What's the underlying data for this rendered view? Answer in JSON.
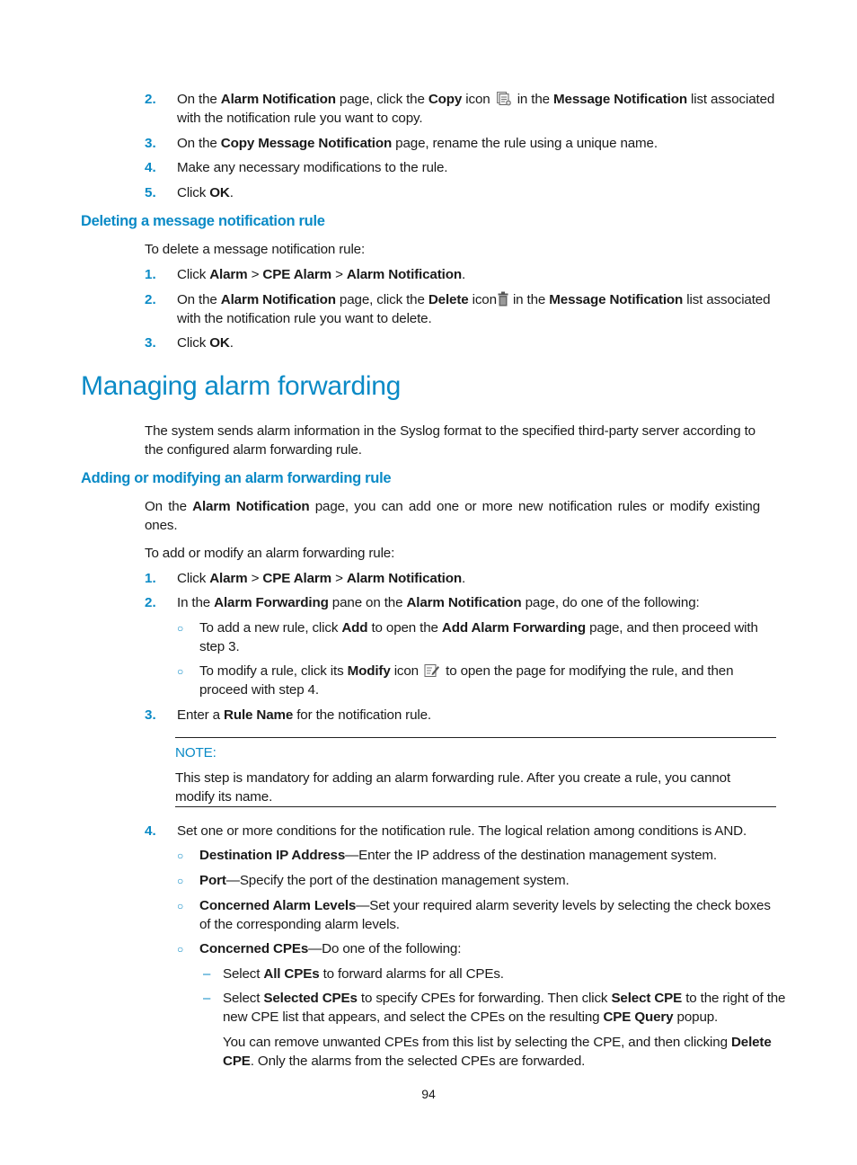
{
  "copy_section": {
    "steps": [
      {
        "num": "2.",
        "parts": [
          "On the ",
          "Alarm Notification",
          " page, click the ",
          "Copy",
          " icon",
          " in the ",
          "Message Notification",
          " list associated"
        ],
        "cont": "with the notification rule you want to copy."
      },
      {
        "num": "3.",
        "parts": [
          "On the ",
          "Copy Message Notification",
          " page, rename the rule using a unique name."
        ]
      },
      {
        "num": "4.",
        "text": "Make any necessary modifications to the rule."
      },
      {
        "num": "5.",
        "parts": [
          "Click ",
          "OK",
          "."
        ]
      }
    ]
  },
  "delete_section": {
    "heading": "Deleting a message notification rule",
    "intro": "To delete a message notification rule:",
    "steps": [
      {
        "num": "1.",
        "parts": [
          "Click ",
          "Alarm",
          " > ",
          "CPE Alarm",
          " > ",
          "Alarm Notification",
          "."
        ]
      },
      {
        "num": "2.",
        "parts": [
          "On the ",
          "Alarm Notification",
          " page, click the ",
          "Delete",
          " icon",
          " in the ",
          "Message Notification",
          " list associated"
        ],
        "cont": "with the notification rule you want to delete."
      },
      {
        "num": "3.",
        "parts": [
          "Click ",
          "OK",
          "."
        ]
      }
    ]
  },
  "forwarding": {
    "title": "Managing alarm forwarding",
    "intro_line1": "The system sends alarm information in the Syslog format to the specified third-party server according to",
    "intro_line2": "the configured alarm forwarding rule.",
    "subheading": "Adding or modifying an alarm forwarding rule",
    "para1_parts": [
      "On the ",
      "Alarm Notification",
      " page, you can add one or more new notification rules or modify existing"
    ],
    "para1_cont": "ones.",
    "intro2": "To add or modify an alarm forwarding rule:",
    "step1": {
      "num": "1.",
      "parts": [
        "Click ",
        "Alarm",
        " > ",
        "CPE Alarm",
        " > ",
        "Alarm Notification",
        "."
      ]
    },
    "step2": {
      "num": "2.",
      "parts": [
        "In the ",
        "Alarm Forwarding",
        " pane on the ",
        "Alarm Notification",
        " page, do one of the following:"
      ]
    },
    "step2_opt1": {
      "parts": [
        "To add a new rule, click ",
        "Add",
        " to open the ",
        "Add Alarm Forwarding",
        " page, and then proceed with"
      ],
      "cont": "step 3."
    },
    "step2_opt2": {
      "parts": [
        "To modify a rule, click its ",
        "Modify",
        " icon",
        " to open the page for modifying the rule, and then"
      ],
      "cont": "proceed with step 4."
    },
    "step3": {
      "num": "3.",
      "parts": [
        "Enter a ",
        "Rule Name",
        " for the notification rule."
      ]
    },
    "note": {
      "label": "NOTE:",
      "line1": "This step is mandatory for adding an alarm forwarding rule. After you create a rule, you cannot",
      "line2": "modify its name."
    },
    "step4": {
      "num": "4.",
      "text": "Set one or more conditions for the notification rule. The logical relation among conditions is AND."
    },
    "conditions": [
      {
        "term": "Destination IP Address",
        "desc": "—Enter the IP address of the destination management system."
      },
      {
        "term": "Port",
        "desc": "—Specify the port of the destination management system."
      },
      {
        "term": "Concerned Alarm Levels",
        "desc": "—Set your required alarm severity levels by selecting the check boxes",
        "cont": "of the corresponding alarm levels."
      },
      {
        "term": "Concerned CPEs",
        "desc": "—Do one of the following:"
      }
    ],
    "cpe_options": [
      {
        "parts": [
          "Select ",
          "All CPEs",
          " to forward alarms for all CPEs."
        ]
      },
      {
        "parts": [
          "Select ",
          "Selected CPEs",
          " to specify CPEs for forwarding. Then click ",
          "Select CPE",
          " to the right of the"
        ],
        "cont_parts": [
          "new CPE list that appears, and select the CPEs on the resulting ",
          "CPE Query",
          " popup."
        ]
      }
    ],
    "cpe_note_parts": [
      "You can remove unwanted CPEs from this list by selecting the CPE, and then clicking ",
      "Delete"
    ],
    "cpe_note_cont_parts": [
      "CPE",
      ". Only the alarms from the selected CPEs are forwarded."
    ]
  },
  "icons": {
    "copy": "copy-icon",
    "delete": "trash-icon",
    "modify": "edit-icon"
  },
  "colors": {
    "accent": "#0a8ac6",
    "text": "#1a1a1a"
  },
  "page_number": "94"
}
